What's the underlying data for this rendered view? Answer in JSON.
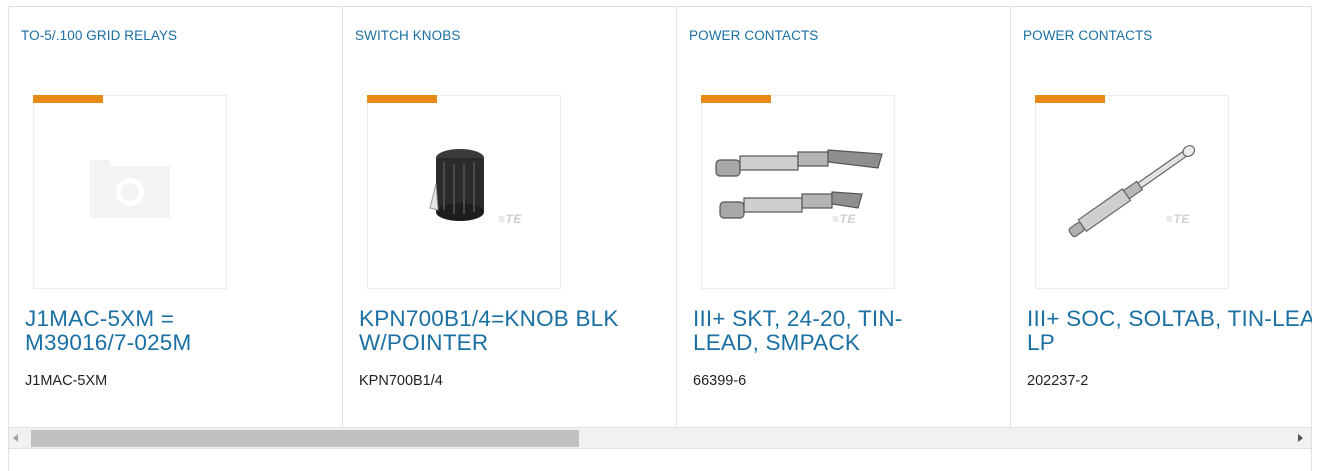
{
  "products": [
    {
      "category": "TO-5/.100 GRID RELAYS",
      "title": "J1MAC-5XM = M39016/7-025M",
      "part_number": "J1MAC-5XM",
      "image": "placeholder-camera-icon"
    },
    {
      "category": "SWITCH KNOBS",
      "title": "KPN700B1/4=KNOB BLK W/POINTER",
      "part_number": "KPN700B1/4",
      "image": "knob-image"
    },
    {
      "category": "POWER CONTACTS",
      "title": "III+ SKT, 24-20, TIN-LEAD, SMPACK",
      "part_number": "66399-6",
      "image": "socket-contacts-image"
    },
    {
      "category": "POWER CONTACTS",
      "title": "III+ SOC, SOLTAB, TIN-LEAD, LP",
      "part_number": "202237-2",
      "image": "solder-tab-contact-image"
    }
  ],
  "watermark": "≡TE",
  "colors": {
    "accent": "#e88a16",
    "link": "#1a6fa3",
    "text": "#222222",
    "border": "#e2e2e2"
  }
}
